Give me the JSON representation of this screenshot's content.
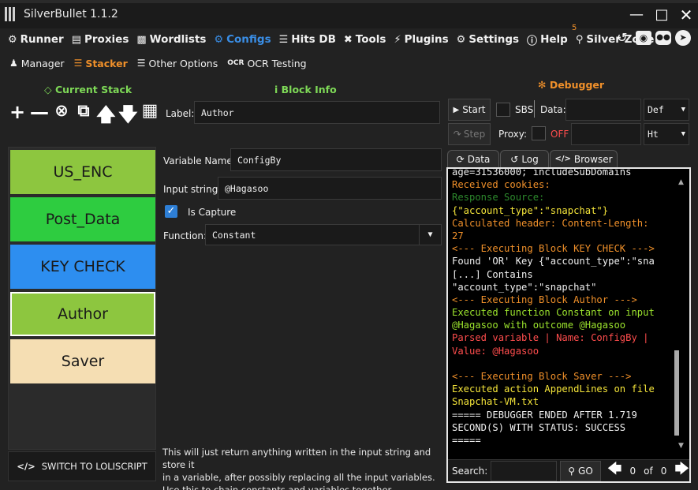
{
  "window": {
    "title": "SilverBullet 1.1.2"
  },
  "main_menu": [
    {
      "label": "Runner",
      "icon": "runner-icon",
      "active": false
    },
    {
      "label": "Proxies",
      "icon": "proxies-icon",
      "active": false
    },
    {
      "label": "Wordlists",
      "icon": "wordlists-icon",
      "active": false
    },
    {
      "label": "Configs",
      "icon": "gear-icon",
      "active": true
    },
    {
      "label": "Hits DB",
      "icon": "database-icon",
      "active": false
    },
    {
      "label": "Tools",
      "icon": "tools-icon",
      "active": false
    },
    {
      "label": "Plugins",
      "icon": "plug-icon",
      "active": false
    },
    {
      "label": "Settings",
      "icon": "gear-icon",
      "active": false
    },
    {
      "label": "Help",
      "icon": "help-icon",
      "active": false
    },
    {
      "label": "Silver Zone",
      "icon": "pin-icon",
      "active": false
    }
  ],
  "silver_zone_badge": "5",
  "sub_menu": [
    {
      "label": "Manager",
      "active": false
    },
    {
      "label": "Stacker",
      "active": true
    },
    {
      "label": "Other Options",
      "active": false
    },
    {
      "label": "OCR Testing",
      "active": false
    }
  ],
  "stack": {
    "title": "Current Stack",
    "blocks": [
      {
        "label": "US_ENC",
        "color": "#8dc63f"
      },
      {
        "label": "Post_Data",
        "color": "#2ecc40"
      },
      {
        "label": "KEY CHECK",
        "color": "#2d8ef0"
      },
      {
        "label": "Author",
        "color": "#8dc63f",
        "selected": true
      },
      {
        "label": "Saver",
        "color": "#f5deb3"
      }
    ],
    "switch_label": "SWITCH TO LOLISCRIPT"
  },
  "block_info": {
    "title": "Block Info",
    "label_caption": "Label:",
    "label_value": "Author",
    "variable_caption": "Variable Name:",
    "variable_value": "ConfigBy",
    "input_caption": "Input string:",
    "input_value": "@Hagasoo",
    "capture_caption": "Is Capture",
    "function_caption": "Function:",
    "function_value": "Constant",
    "help_line1": "This will just return anything written in the input string and store it",
    "help_line2": "in a variable, after possibly replacing all the input variables.",
    "help_line3": "Use this to chain constants and variables together."
  },
  "debugger": {
    "title": "Debugger",
    "start_label": "Start",
    "step_label": "Step",
    "sbs_label": "SBS",
    "data_label": "Data:",
    "data_select": "Def",
    "proxy_label": "Proxy:",
    "proxy_state": "OFF",
    "proxy_select": "Ht",
    "tabs": [
      "Data",
      "Log",
      "Browser"
    ],
    "search_label": "Search:",
    "go_label": "GO",
    "match_current": "0",
    "match_of": "of",
    "match_total": "0"
  },
  "log_lines": [
    {
      "text": "age=31536000; includeSubDomains",
      "color": "#f0f0f0"
    },
    {
      "text": "Received cookies:",
      "color": "#f0902a"
    },
    {
      "text": "Response Source:",
      "color": "#2d8a2d"
    },
    {
      "text": "{\"account_type\":\"snapchat\"}",
      "color": "#f5e53a"
    },
    {
      "text": "Calculated header: Content-Length:",
      "color": "#f0902a"
    },
    {
      "text": "27",
      "color": "#f0902a"
    },
    {
      "text": "<--- Executing Block KEY CHECK --->",
      "color": "#f0902a"
    },
    {
      "text": "Found 'OR' Key {\"account_type\":\"sna",
      "color": "#f0f0f0"
    },
    {
      "text": "[...] Contains",
      "color": "#f0f0f0"
    },
    {
      "text": "\"account_type\":\"snapchat\"",
      "color": "#f0f0f0"
    },
    {
      "text": "<--- Executing Block Author --->",
      "color": "#f0902a"
    },
    {
      "text": "Executed function Constant on input",
      "color": "#9be22d"
    },
    {
      "text": "@Hagasoo with outcome @Hagasoo",
      "color": "#9be22d"
    },
    {
      "text": "Parsed variable | Name: ConfigBy |",
      "color": "#ff4d4d"
    },
    {
      "text": "Value: @Hagasoo",
      "color": "#ff4d4d"
    },
    {
      "text": "",
      "color": "#f0f0f0"
    },
    {
      "text": "<--- Executing Block Saver --->",
      "color": "#f0902a"
    },
    {
      "text": "Executed action AppendLines on file",
      "color": "#f5e53a"
    },
    {
      "text": "Snapchat-VM.txt",
      "color": "#f5e53a"
    },
    {
      "text": "===== DEBUGGER ENDED AFTER 1.719",
      "color": "#f0f0f0"
    },
    {
      "text": "SECOND(S) WITH STATUS: SUCCESS",
      "color": "#f0f0f0"
    },
    {
      "text": "=====",
      "color": "#f0f0f0"
    }
  ]
}
